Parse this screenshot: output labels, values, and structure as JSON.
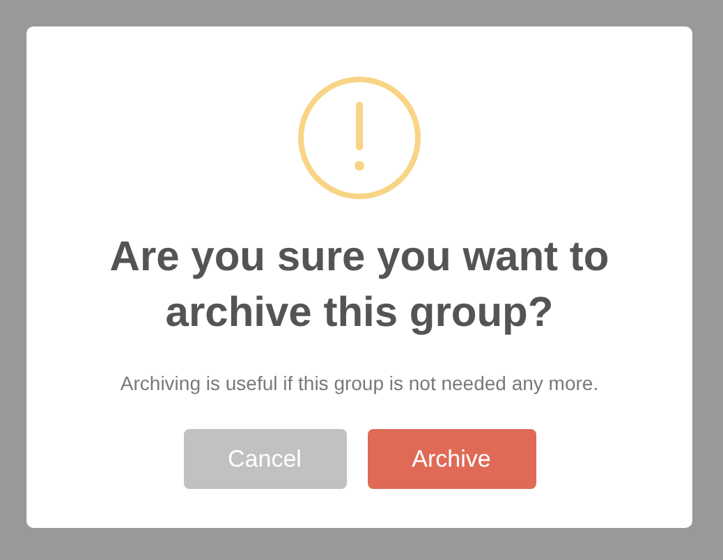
{
  "dialog": {
    "title": "Are you sure you want to archive this group?",
    "message": "Archiving is useful if this group is not needed any more.",
    "buttons": [
      {
        "label": "Cancel",
        "kind": "cancel"
      },
      {
        "label": "Archive",
        "kind": "confirm"
      }
    ]
  }
}
